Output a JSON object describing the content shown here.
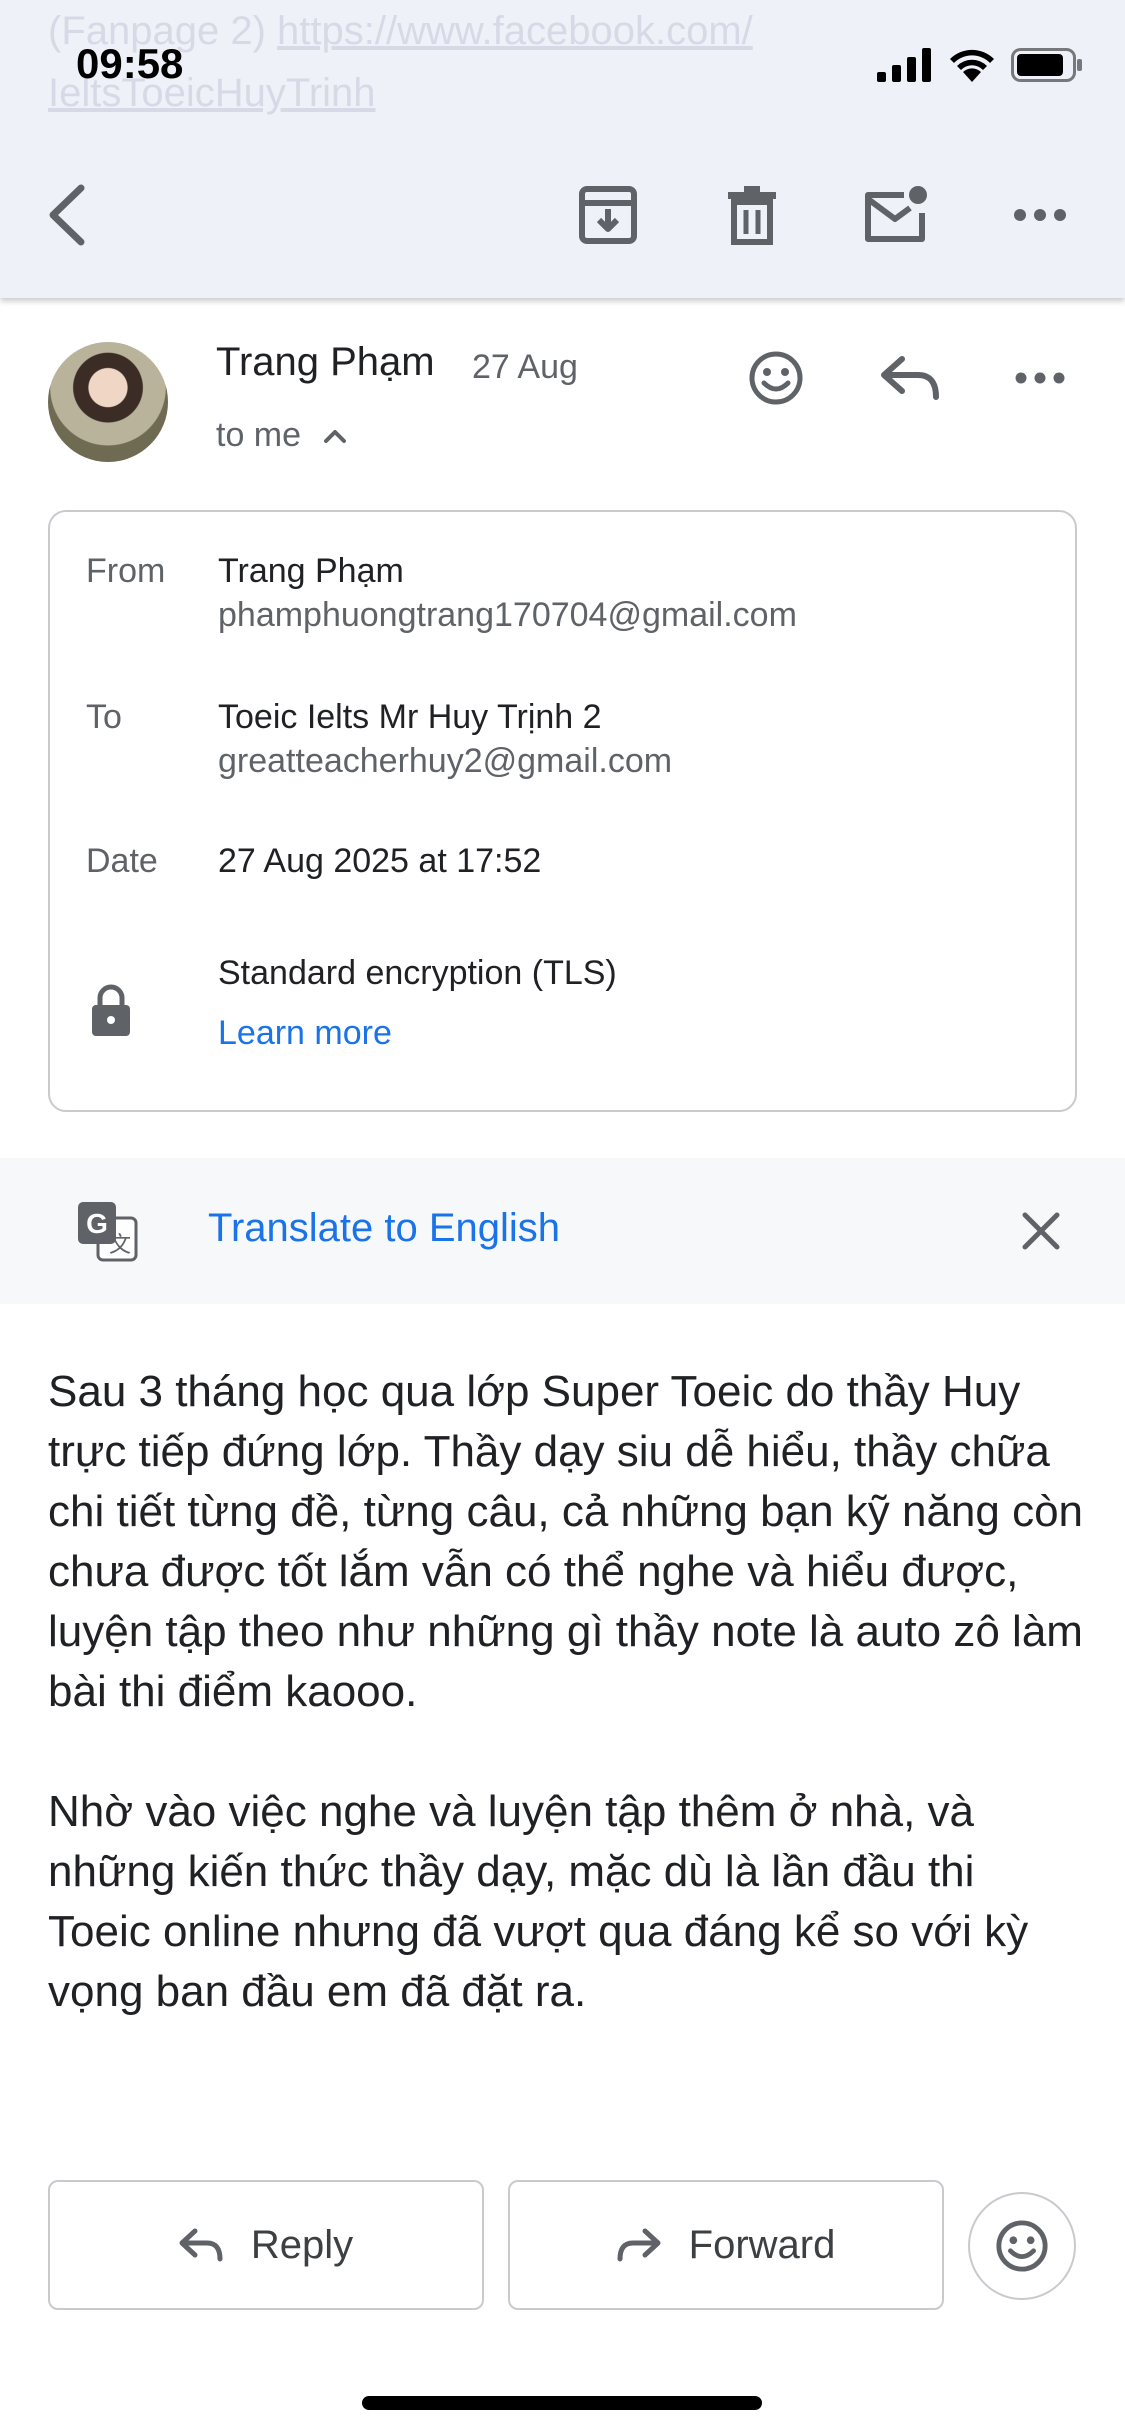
{
  "background_text": {
    "line1_prefix": "(Fanpage 2) ",
    "line1_link": "https://www.facebook.com/",
    "line2_link": "IeltsToeicHuyTrinh"
  },
  "status_bar": {
    "time": "09:58",
    "icons": [
      "signal-icon",
      "wifi-icon",
      "battery-icon"
    ]
  },
  "toolbar": {
    "icons": [
      "back-arrow-icon",
      "archive-icon",
      "trash-icon",
      "mark-unread-icon",
      "more-icon"
    ]
  },
  "message": {
    "sender_name": "Trang Phạm",
    "date": "27 Aug",
    "recipient_summary": "to me",
    "header_icons": [
      "emoji-react-icon",
      "reply-icon",
      "more-icon"
    ]
  },
  "details": {
    "from_label": "From",
    "from_name": "Trang Phạm",
    "from_email": "phamphuongtrang170704@gmail.com",
    "to_label": "To",
    "to_name": "Toeic Ielts Mr Huy Trịnh 2",
    "to_email": "greatteacherhuy2@gmail.com",
    "date_label": "Date",
    "date_value": "27 Aug 2025 at 17:52",
    "encryption": "Standard encryption (TLS)",
    "learn_more": "Learn more"
  },
  "translate": {
    "label": "Translate to English"
  },
  "body": {
    "paragraph1": "Sau 3 tháng học qua lớp Super Toeic do thầy Huy trực tiếp đứng lớp. Thầy dạy siu dễ hiểu, thầy chữa chi tiết từng đề, từng câu, cả những bạn kỹ năng còn chưa được tốt lắm vẫn có thể nghe và hiểu được, luyện tập theo như những gì thầy note là auto zô làm bài thi điểm kaooo.",
    "paragraph2": "Nhờ vào việc nghe và luyện tập thêm ở nhà, và những kiến thức thầy dạy, mặc dù là lần đầu thi Toeic online nhưng đã vượt qua đáng kể so với kỳ vọng ban đầu em đã đặt ra."
  },
  "actions": {
    "reply_label": "Reply",
    "forward_label": "Forward"
  },
  "colors": {
    "accent": "#1a73e8",
    "toolbar_bg": "#eef1f7",
    "icon": "#5f6368"
  }
}
